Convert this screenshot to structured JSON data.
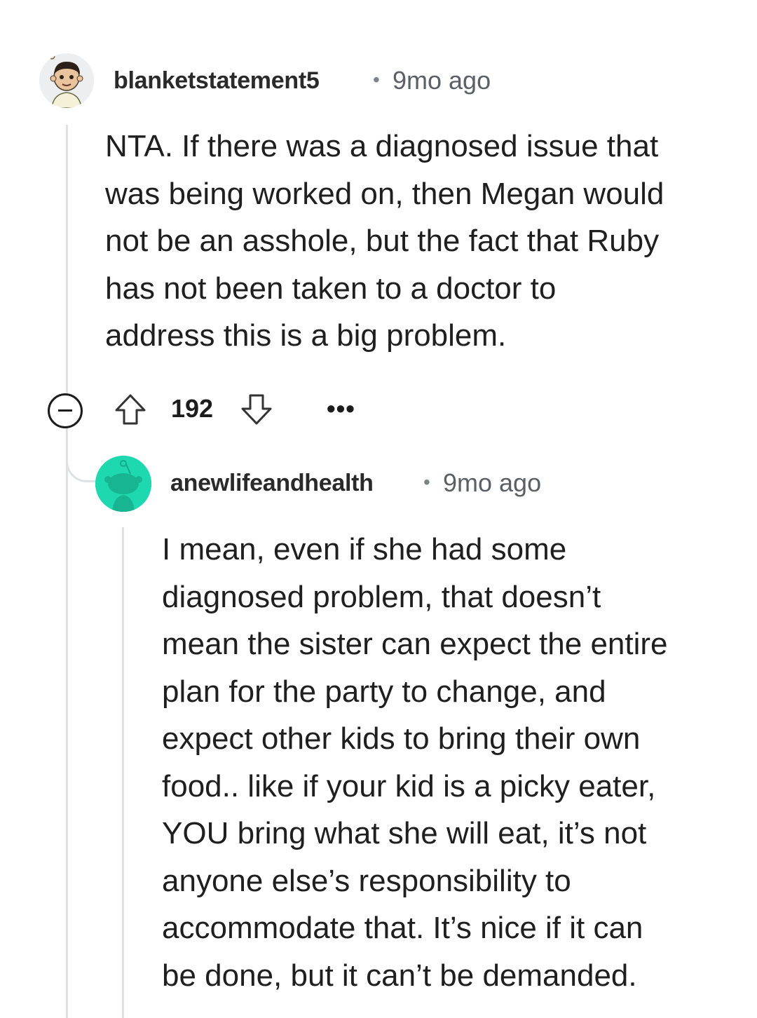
{
  "comments": [
    {
      "username": "blanketstatement5",
      "separator": "•",
      "timestamp": "9mo ago",
      "body": "NTA. If there was a diagnosed issue that\nwas being worked on, then Megan would\nnot be an asshole, but the fact that Ruby\nhas not been taken to a doctor to\naddress this is a big problem.",
      "score": "192",
      "avatar_icon": "cartoon-person-avatar"
    },
    {
      "username": "anewlifeandhealth",
      "separator": "•",
      "timestamp": "9mo ago",
      "body": "I mean, even if she had some\ndiagnosed problem, that doesn’t\nmean the sister can expect the entire\nplan for the party to change, and\nexpect other kids to bring their own\nfood.. like if your kid is a picky eater,\nYOU bring what she will eat, it’s not\nanyone else’s responsibility to\naccommodate that. It’s nice if it can\nbe done, but it can’t be demanded.",
      "avatar_icon": "snoo-avatar",
      "avatar_color": "#1ed8b0"
    }
  ],
  "actions": {
    "collapse_icon": "minus-circle-icon",
    "upvote_icon": "arrow-up-icon",
    "downvote_icon": "arrow-down-icon",
    "more_label": "•••"
  }
}
